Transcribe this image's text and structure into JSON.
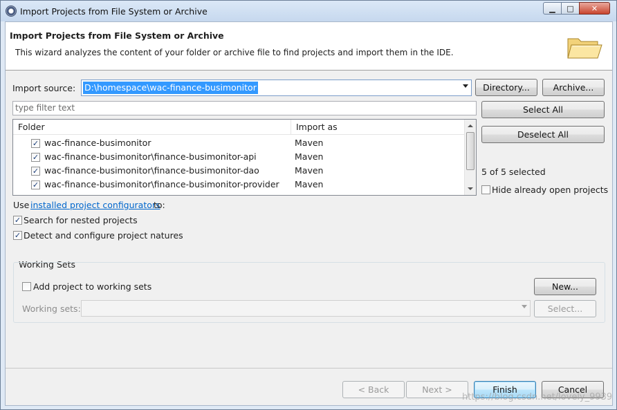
{
  "window": {
    "title": "Import Projects from File System or Archive",
    "min_glyph": "▁",
    "max_glyph": "□",
    "close_glyph": "✕"
  },
  "header": {
    "title": "Import Projects from File System or Archive",
    "description": "This wizard analyzes the content of your folder or archive file to find projects and import them in the IDE."
  },
  "source": {
    "label": "Import source:",
    "value": "D:\\homespace\\wac-finance-busimonitor",
    "directory_button": "Directory...",
    "archive_button": "Archive..."
  },
  "filter": {
    "placeholder": "type filter text"
  },
  "table": {
    "columns": [
      "Folder",
      "Import as"
    ],
    "rows": [
      {
        "folder": "wac-finance-busimonitor",
        "import_as": "Maven",
        "checked": true
      },
      {
        "folder": "wac-finance-busimonitor\\finance-busimonitor-api",
        "import_as": "Maven",
        "checked": true
      },
      {
        "folder": "wac-finance-busimonitor\\finance-busimonitor-dao",
        "import_as": "Maven",
        "checked": true
      },
      {
        "folder": "wac-finance-busimonitor\\finance-busimonitor-provider",
        "import_as": "Maven",
        "checked": true
      }
    ]
  },
  "side": {
    "select_all": "Select All",
    "deselect_all": "Deselect All",
    "selected_count": "5 of 5 selected",
    "hide_open": "Hide already open projects"
  },
  "configurators": {
    "prefix": "Use",
    "link": "installed project configurators",
    "suffix": "to:"
  },
  "options": {
    "nested": "Search for nested projects",
    "natures": "Detect and configure project natures"
  },
  "working_sets": {
    "group_label": "Working Sets",
    "add_label": "Add project to working sets",
    "new_button": "New...",
    "sets_label": "Working sets:",
    "select_button": "Select..."
  },
  "nav": {
    "back": "< Back",
    "next": "Next >",
    "finish": "Finish",
    "cancel": "Cancel"
  },
  "watermark": "https://blog.csdn.net/lovely_9939",
  "icons": {
    "check": "✓"
  }
}
